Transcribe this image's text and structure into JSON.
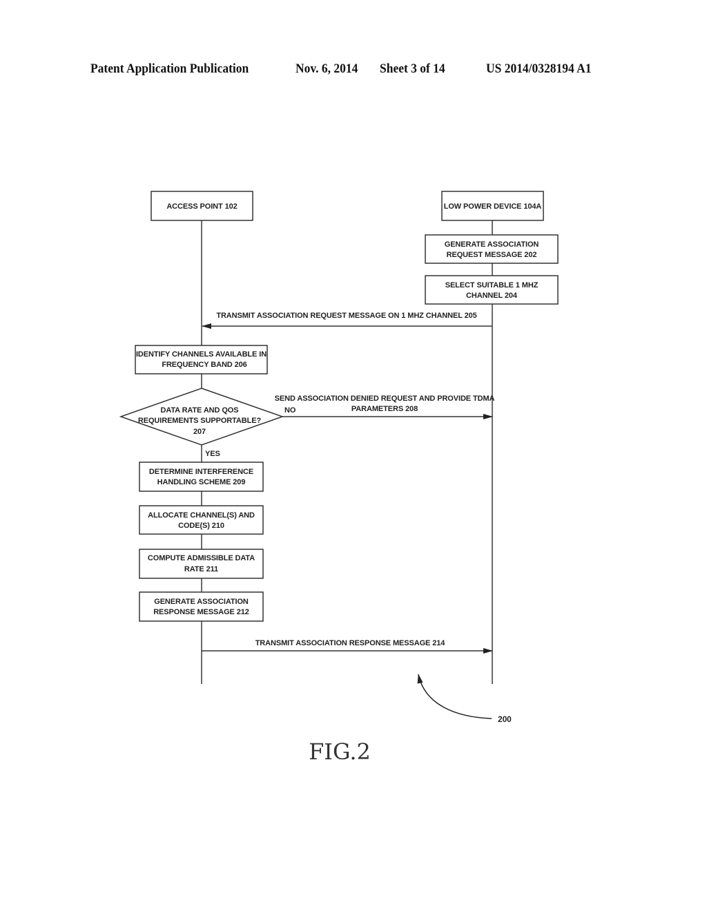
{
  "header": {
    "publication": "Patent Application Publication",
    "date": "Nov. 6, 2014",
    "sheet": "Sheet 3 of 14",
    "number": "US 2014/0328194 A1"
  },
  "participants": {
    "access_point": "ACCESS POINT 102",
    "low_power_device": "LOW POWER DEVICE 104A"
  },
  "device_steps": [
    {
      "line1": "GENERATE ASSOCIATION",
      "line2": "REQUEST MESSAGE 202"
    },
    {
      "line1": "SELECT SUITABLE 1 MHZ",
      "line2": "CHANNEL 204"
    }
  ],
  "messages": {
    "request": "TRANSMIT ASSOCIATION REQUEST MESSAGE ON 1 MHZ CHANNEL 205",
    "denied_line1": "SEND ASSOCIATION DENIED REQUEST AND PROVIDE TDMA",
    "denied_line2": "PARAMETERS 208",
    "response": "TRANSMIT ASSOCIATION RESPONSE MESSAGE 214"
  },
  "ap_steps": {
    "identify": {
      "line1": "IDENTIFY CHANNELS AVAILABLE IN",
      "line2": "FREQUENCY BAND 206"
    },
    "decision": {
      "line1": "DATA RATE AND QOS",
      "line2": "REQUIREMENTS SUPPORTABLE?",
      "line3": "207",
      "no_label": "NO",
      "yes_label": "YES"
    },
    "interference": {
      "line1": "DETERMINE INTERFERENCE",
      "line2": "HANDLING SCHEME 209"
    },
    "allocate": {
      "line1": "ALLOCATE CHANNEL(S) AND",
      "line2": "CODE(S) 210"
    },
    "compute": {
      "line1": "COMPUTE ADMISSIBLE DATA",
      "line2": "RATE 211"
    },
    "generate": {
      "line1": "GENERATE ASSOCIATION",
      "line2": "RESPONSE MESSAGE 212"
    }
  },
  "reference_numeral": "200",
  "figure_label": "FIG.2"
}
